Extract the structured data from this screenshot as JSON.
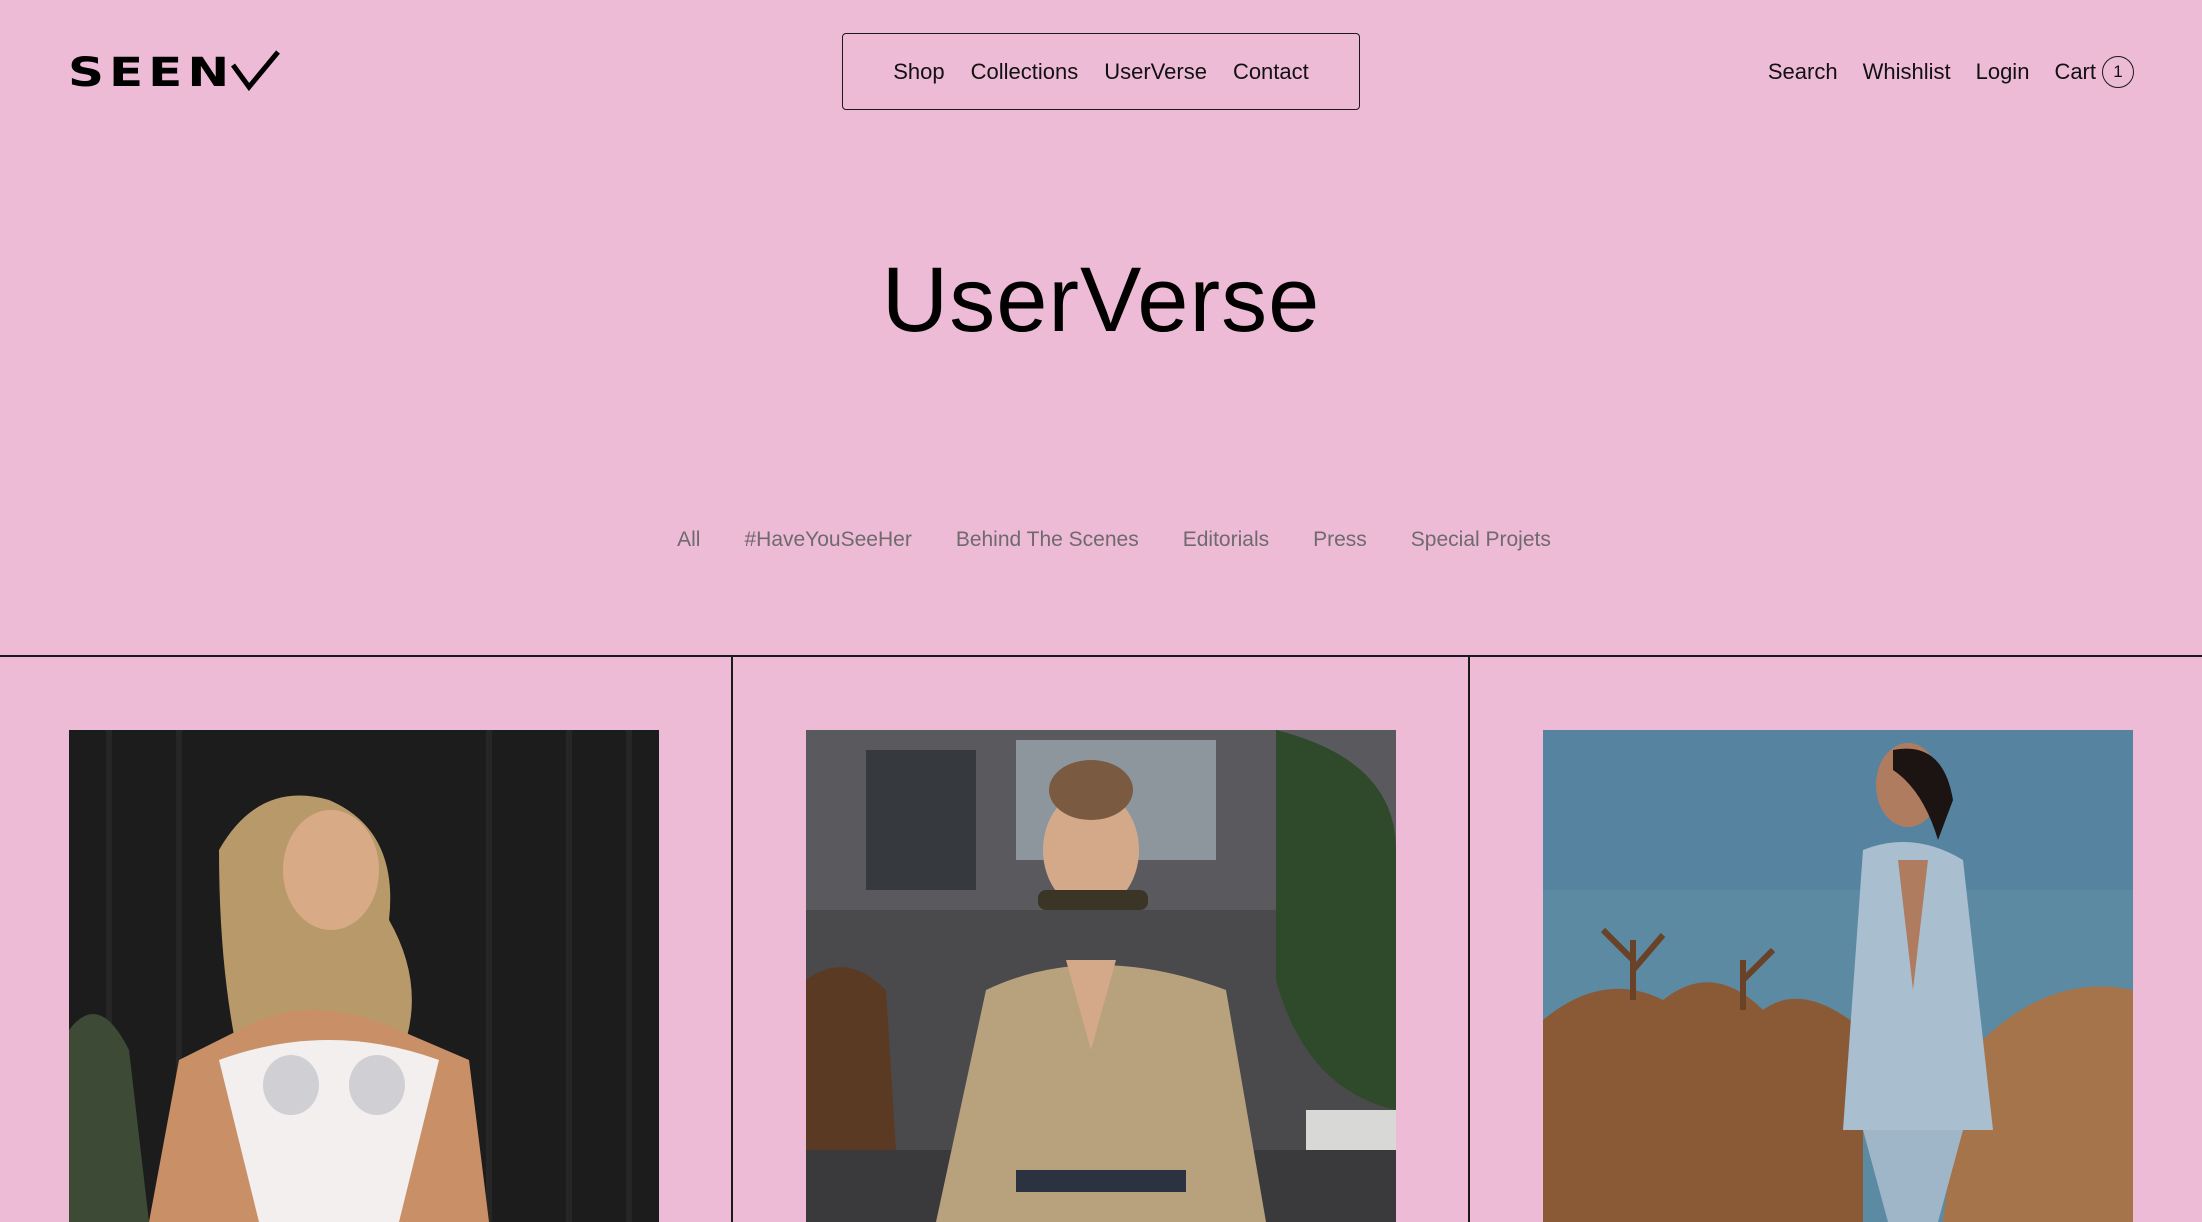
{
  "brand": {
    "logo_text": "SEEN"
  },
  "nav": {
    "main": [
      "Shop",
      "Collections",
      "UserVerse",
      "Contact"
    ],
    "utility": {
      "search": "Search",
      "wishlist": "Whishlist",
      "login": "Login",
      "cart": "Cart",
      "cart_count": "1"
    }
  },
  "page": {
    "title": "UserVerse"
  },
  "filters": [
    "All",
    "#HaveYouSeeHer",
    "Behind The Scenes",
    "Editorials",
    "Press",
    "Special Projets"
  ],
  "colors": {
    "background": "#EDBBD6",
    "text": "#111111",
    "filter_text": "#6F6A6E"
  },
  "cards": [
    {
      "icon": "photo-white-corset"
    },
    {
      "icon": "photo-street-style-beige"
    },
    {
      "icon": "photo-denim-desert"
    }
  ]
}
